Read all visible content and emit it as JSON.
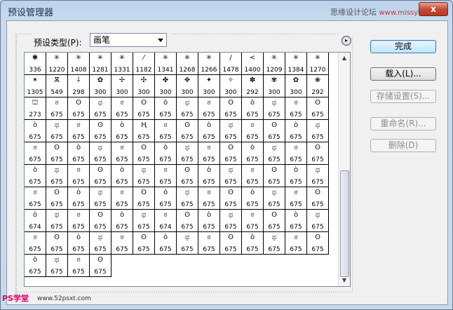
{
  "window": {
    "title": "预设管理器",
    "close_label": "x"
  },
  "watermark_top": {
    "text": "思缘设计论坛",
    "url": "www.missyuan.com"
  },
  "watermark_bottom": {
    "text": "PS学堂",
    "url": "www.52psxt.com"
  },
  "preset_type": {
    "label": "预设类型(P):",
    "value": "画笔"
  },
  "buttons": {
    "done": "完成",
    "load": "载入(L)...",
    "save": "存储设置(S)...",
    "rename": "重命名(R)...",
    "delete": "删除(D)"
  },
  "presets": [
    {
      "g": "✱",
      "n": "336"
    },
    {
      "g": "✳",
      "n": "1220"
    },
    {
      "g": "✳",
      "n": "1408"
    },
    {
      "g": "✳",
      "n": "1281"
    },
    {
      "g": "✳",
      "n": "1331"
    },
    {
      "g": "⁄",
      "n": "1182"
    },
    {
      "g": "✳",
      "n": "1341"
    },
    {
      "g": "✳",
      "n": "1268"
    },
    {
      "g": "✳",
      "n": "1266"
    },
    {
      "g": "/",
      "n": "1478"
    },
    {
      "g": "<",
      "n": "1400"
    },
    {
      "g": "✳",
      "n": "1209"
    },
    {
      "g": "✳",
      "n": "1384"
    },
    {
      "g": "✳",
      "n": "1270"
    },
    {
      "g": "✶",
      "n": "1305"
    },
    {
      "g": "Ѫ",
      "n": "549"
    },
    {
      "g": "⸸",
      "n": "298"
    },
    {
      "g": "✿",
      "n": "300"
    },
    {
      "g": "✢",
      "n": "300"
    },
    {
      "g": "✣",
      "n": "300"
    },
    {
      "g": "✤",
      "n": "300"
    },
    {
      "g": "✥",
      "n": "300"
    },
    {
      "g": "✦",
      "n": "300"
    },
    {
      "g": "✧",
      "n": "300"
    },
    {
      "g": "✽",
      "n": "292"
    },
    {
      "g": "✾",
      "n": "300"
    },
    {
      "g": "✿",
      "n": "300"
    },
    {
      "g": "❀",
      "n": "292"
    },
    {
      "g": "⛫",
      "n": "273"
    },
    {
      "g": "ಠ",
      "n": "675"
    },
    {
      "g": "ʘ",
      "n": "675"
    },
    {
      "g": "ಥ",
      "n": "675"
    },
    {
      "g": "ಠ",
      "n": "675"
    },
    {
      "g": "ʘ",
      "n": "675"
    },
    {
      "g": "ò",
      "n": "675"
    },
    {
      "g": "ಥ",
      "n": "675"
    },
    {
      "g": "ಠ",
      "n": "675"
    },
    {
      "g": "ʘ",
      "n": "675"
    },
    {
      "g": "ò",
      "n": "675"
    },
    {
      "g": "ಥ",
      "n": "675"
    },
    {
      "g": "ಠ",
      "n": "675"
    },
    {
      "g": "ʘ",
      "n": "675"
    },
    {
      "g": "ò",
      "n": "675"
    },
    {
      "g": "ಥ",
      "n": "675"
    },
    {
      "g": "ಠ",
      "n": "675"
    },
    {
      "g": "ʘ",
      "n": "675"
    },
    {
      "g": "ò",
      "n": "675"
    },
    {
      "g": "Ⱨ",
      "n": "675"
    },
    {
      "g": "ಠ",
      "n": "675"
    },
    {
      "g": "ʘ",
      "n": "675"
    },
    {
      "g": "ò",
      "n": "675"
    },
    {
      "g": "ಥ",
      "n": "675"
    },
    {
      "g": "ಠ",
      "n": "675"
    },
    {
      "g": "ʘ",
      "n": "675"
    },
    {
      "g": "ò",
      "n": "675"
    },
    {
      "g": "ಥ",
      "n": "675"
    },
    {
      "g": "ಠ",
      "n": "675"
    },
    {
      "g": "ʘ",
      "n": "675"
    },
    {
      "g": "ò",
      "n": "675"
    },
    {
      "g": "ಥ",
      "n": "675"
    },
    {
      "g": "ಠ",
      "n": "675"
    },
    {
      "g": "ʘ",
      "n": "675"
    },
    {
      "g": "ò",
      "n": "675"
    },
    {
      "g": "ಥ",
      "n": "675"
    },
    {
      "g": "ಠ",
      "n": "675"
    },
    {
      "g": "ʘ",
      "n": "675"
    },
    {
      "g": "ò",
      "n": "675"
    },
    {
      "g": "ಥ",
      "n": "675"
    },
    {
      "g": "ಠ",
      "n": "675"
    },
    {
      "g": "ʘ",
      "n": "675"
    },
    {
      "g": "ò",
      "n": "675"
    },
    {
      "g": "ಥ",
      "n": "675"
    },
    {
      "g": "ಠ",
      "n": "675"
    },
    {
      "g": "ʘ",
      "n": "675"
    },
    {
      "g": "ò",
      "n": "675"
    },
    {
      "g": "ಥ",
      "n": "675"
    },
    {
      "g": "ಠ",
      "n": "675"
    },
    {
      "g": "ʘ",
      "n": "675"
    },
    {
      "g": "ò",
      "n": "675"
    },
    {
      "g": "ಥ",
      "n": "675"
    },
    {
      "g": "ಠ",
      "n": "675"
    },
    {
      "g": "ʘ",
      "n": "675"
    },
    {
      "g": "ò",
      "n": "675"
    },
    {
      "g": "ಥ",
      "n": "675"
    },
    {
      "g": "ಠ",
      "n": "675"
    },
    {
      "g": "ʘ",
      "n": "675"
    },
    {
      "g": "ò",
      "n": "675"
    },
    {
      "g": "ಥ",
      "n": "675"
    },
    {
      "g": "ಠ",
      "n": "675"
    },
    {
      "g": "ʘ",
      "n": "675"
    },
    {
      "g": "ò",
      "n": "675"
    },
    {
      "g": "ಥ",
      "n": "675"
    },
    {
      "g": "ಠ",
      "n": "675"
    },
    {
      "g": "ʘ",
      "n": "675"
    },
    {
      "g": "ò",
      "n": "675"
    },
    {
      "g": "ಥ",
      "n": "675"
    },
    {
      "g": "ಠ",
      "n": "675"
    },
    {
      "g": "ʘ",
      "n": "675"
    },
    {
      "g": "ò",
      "n": "674"
    },
    {
      "g": "ಥ",
      "n": "675"
    },
    {
      "g": "ಠ",
      "n": "675"
    },
    {
      "g": "ʘ",
      "n": "675"
    },
    {
      "g": "ò",
      "n": "675"
    },
    {
      "g": "ಥ",
      "n": "675"
    },
    {
      "g": "ಠ",
      "n": "674"
    },
    {
      "g": "ʘ",
      "n": "675"
    },
    {
      "g": "ò",
      "n": "675"
    },
    {
      "g": "ಥ",
      "n": "675"
    },
    {
      "g": "ಠ",
      "n": "675"
    },
    {
      "g": "ʘ",
      "n": "675"
    },
    {
      "g": "ò",
      "n": "675"
    },
    {
      "g": "ಥ",
      "n": "675"
    },
    {
      "g": "ಠ",
      "n": "675"
    },
    {
      "g": "ʘ",
      "n": "675"
    },
    {
      "g": "ò",
      "n": "675"
    },
    {
      "g": "ಥ",
      "n": "675"
    },
    {
      "g": "ಠ",
      "n": "675"
    },
    {
      "g": "ʘ",
      "n": "675"
    },
    {
      "g": "ò",
      "n": "675"
    },
    {
      "g": "ಥ",
      "n": "675"
    },
    {
      "g": "ಠ",
      "n": "675"
    },
    {
      "g": "ʘ",
      "n": "675"
    },
    {
      "g": "ò",
      "n": "675"
    },
    {
      "g": "ಥ",
      "n": "675"
    },
    {
      "g": "ಠ",
      "n": "675"
    },
    {
      "g": "ʘ",
      "n": "675"
    },
    {
      "g": "ò",
      "n": "675"
    },
    {
      "g": "ಥ",
      "n": "675"
    },
    {
      "g": "ಠ",
      "n": "675"
    },
    {
      "g": "ʘ",
      "n": "675"
    }
  ]
}
